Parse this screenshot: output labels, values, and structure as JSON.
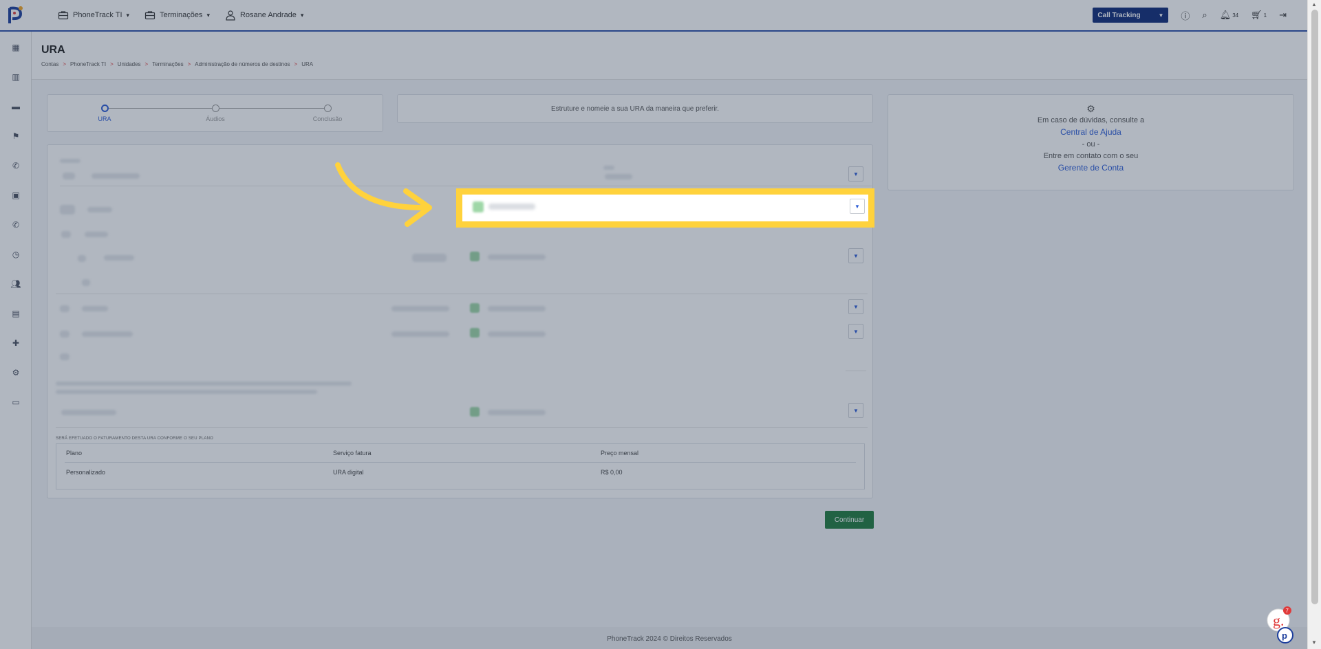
{
  "topbar": {
    "menus": [
      {
        "label": "PhoneTrack TI",
        "icon": "briefcase-icon"
      },
      {
        "label": "Terminações",
        "icon": "briefcase-icon"
      },
      {
        "label": "Rosane Andrade",
        "icon": "user-icon"
      }
    ],
    "product_select": "Call Tracking",
    "notifications_count": "34",
    "cart_count": "1"
  },
  "header": {
    "title": "URA",
    "breadcrumb": [
      "Contas",
      "PhoneTrack TI",
      "Unidades",
      "Terminações",
      "Administração de números de destinos",
      "URA"
    ]
  },
  "stepper": {
    "steps": [
      {
        "label": "URA",
        "active": true
      },
      {
        "label": "Áudios",
        "active": false
      },
      {
        "label": "Conclusão",
        "active": false
      }
    ]
  },
  "info_message": "Estruture e nomeie a sua URA da maneira que preferir.",
  "help": {
    "line1": "Em caso de dúvidas, consulte a",
    "link1": "Central de Ajuda",
    "or": "- ou -",
    "line2": "Entre em contato com o seu",
    "link2": "Gerente de Conta"
  },
  "billing": {
    "note": "SERÁ EFETUADO O FATURAMENTO DESTA URA CONFORME O SEU PLANO",
    "headers": [
      "Plano",
      "Serviço fatura",
      "Preço mensal"
    ],
    "row": [
      "Personalizado",
      "URA digital",
      "R$ 0,00"
    ]
  },
  "continue_label": "Continuar",
  "footer": "PhoneTrack 2024 © Direitos Reservados",
  "colors": {
    "primary": "#2b5bd6",
    "navy": "#0d2a78",
    "success": "#1e7a3c",
    "highlight": "#ffd23c"
  }
}
